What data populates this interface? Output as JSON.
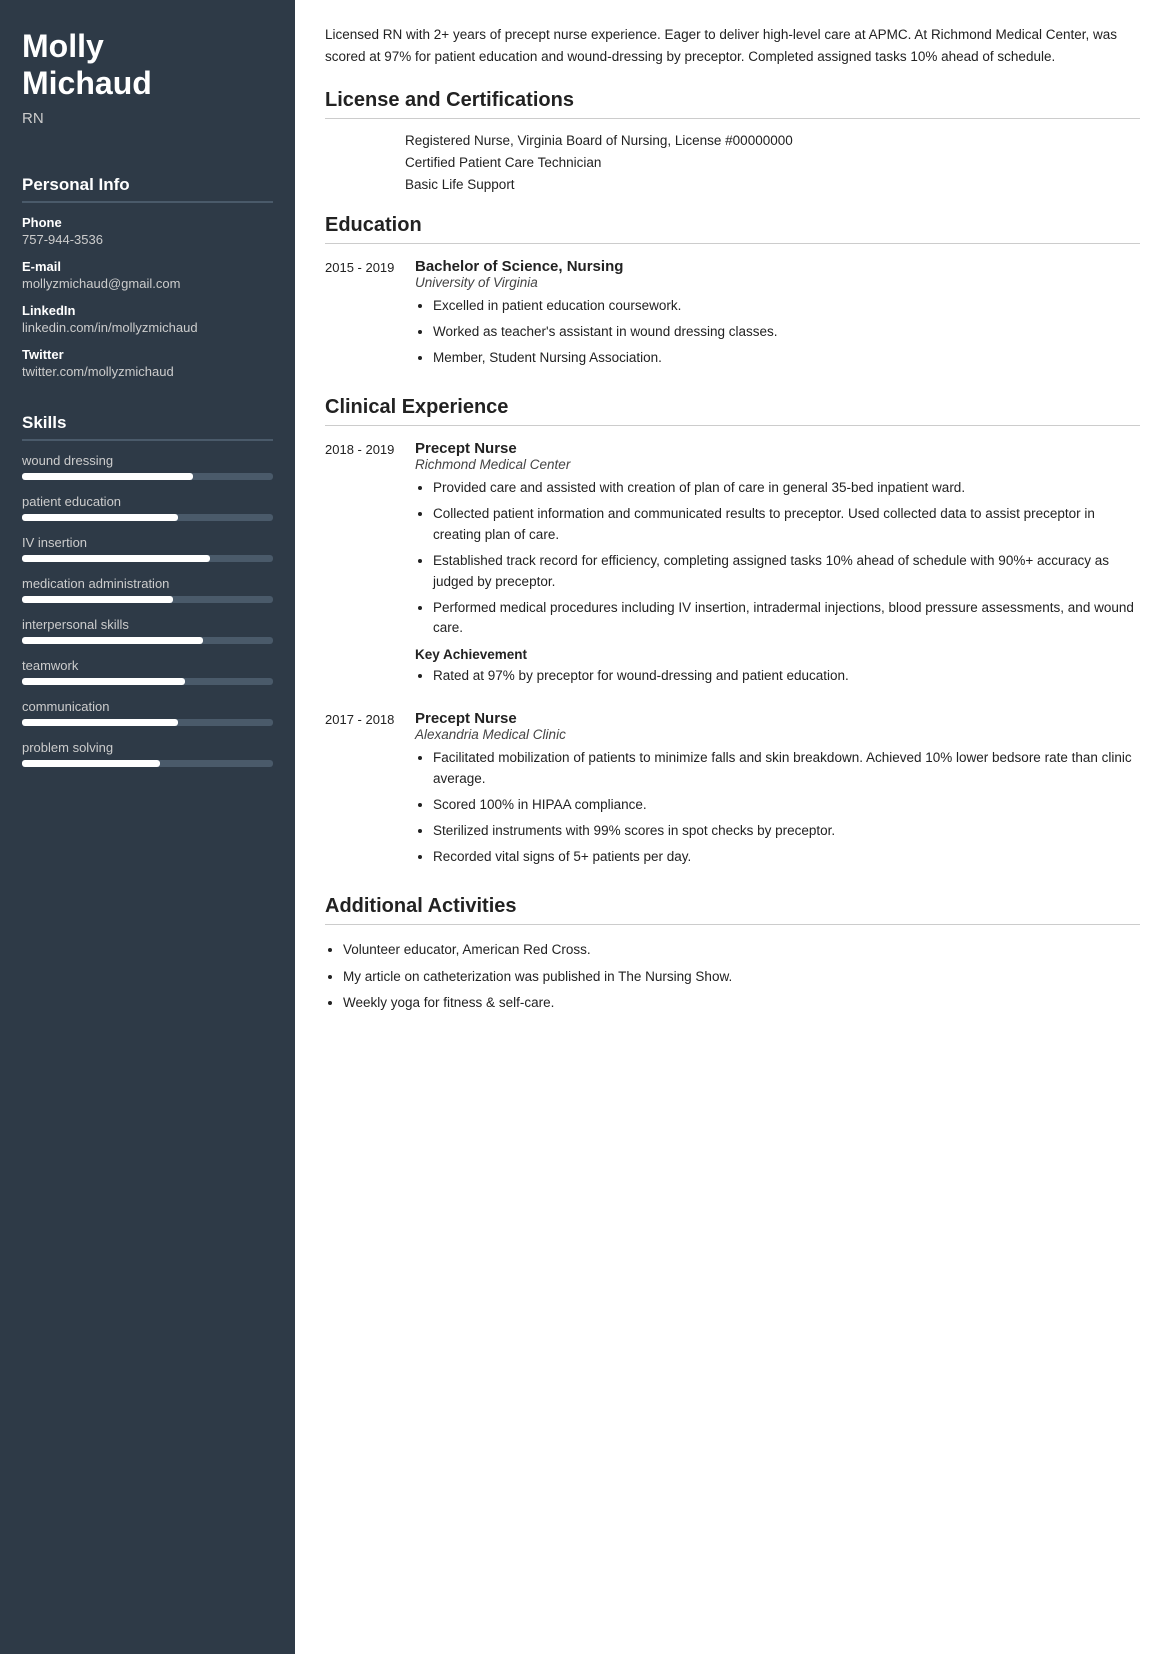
{
  "sidebar": {
    "name_line1": "Molly",
    "name_line2": "Michaud",
    "title": "RN",
    "personal_info_label": "Personal Info",
    "phone_label": "Phone",
    "phone_value": "757-944-3536",
    "email_label": "E-mail",
    "email_value": "mollyzmichaud@gmail.com",
    "linkedin_label": "LinkedIn",
    "linkedin_value": "linkedin.com/in/mollyzmichaud",
    "twitter_label": "Twitter",
    "twitter_value": "twitter.com/mollyzmichaud",
    "skills_label": "Skills",
    "skills": [
      {
        "label": "wound dressing",
        "pct": 68
      },
      {
        "label": "patient education",
        "pct": 62
      },
      {
        "label": "IV insertion",
        "pct": 75
      },
      {
        "label": "medication administration",
        "pct": 60
      },
      {
        "label": "interpersonal skills",
        "pct": 72
      },
      {
        "label": "teamwork",
        "pct": 65
      },
      {
        "label": "communication",
        "pct": 62
      },
      {
        "label": "problem solving",
        "pct": 55
      }
    ]
  },
  "main": {
    "summary": "Licensed RN with 2+ years of precept nurse experience. Eager to deliver high-level care at APMC. At Richmond Medical Center, was scored at 97% for patient education and wound-dressing by preceptor. Completed assigned tasks 10% ahead of schedule.",
    "license_section": {
      "title": "License and Certifications",
      "items": [
        "Registered Nurse, Virginia Board of Nursing, License #00000000",
        "Certified Patient Care Technician",
        "Basic Life Support"
      ]
    },
    "education_section": {
      "title": "Education",
      "entries": [
        {
          "dates": "2015 - 2019",
          "degree": "Bachelor of Science, Nursing",
          "institution": "University of Virginia",
          "bullets": [
            "Excelled in patient education coursework.",
            "Worked as teacher's assistant in wound dressing classes.",
            "Member, Student Nursing Association."
          ]
        }
      ]
    },
    "experience_section": {
      "title": "Clinical Experience",
      "entries": [
        {
          "dates": "2018 - 2019",
          "job_title": "Precept Nurse",
          "employer": "Richmond Medical Center",
          "bullets": [
            "Provided care and assisted with creation of plan of care in general 35-bed inpatient ward.",
            "Collected patient information and communicated results to preceptor. Used collected data to assist preceptor in creating plan of care.",
            "Established track record for efficiency, completing assigned tasks 10% ahead of schedule with 90%+ accuracy as judged by preceptor.",
            "Performed medical procedures including IV insertion, intradermal injections, blood pressure assessments, and wound care."
          ],
          "key_achievement_label": "Key Achievement",
          "key_achievement": "Rated at 97% by preceptor for wound-dressing and patient education."
        },
        {
          "dates": "2017 - 2018",
          "job_title": "Precept Nurse",
          "employer": "Alexandria Medical Clinic",
          "bullets": [
            "Facilitated mobilization of patients to minimize falls and skin breakdown. Achieved 10% lower bedsore rate than clinic average.",
            "Scored 100% in HIPAA compliance.",
            "Sterilized instruments with 99% scores in spot checks by preceptor.",
            "Recorded vital signs of 5+ patients per day."
          ],
          "key_achievement_label": "",
          "key_achievement": ""
        }
      ]
    },
    "activities_section": {
      "title": "Additional Activities",
      "items": [
        "Volunteer educator, American Red Cross.",
        "My article on catheterization was published in The Nursing Show.",
        "Weekly yoga for fitness & self-care."
      ]
    }
  }
}
